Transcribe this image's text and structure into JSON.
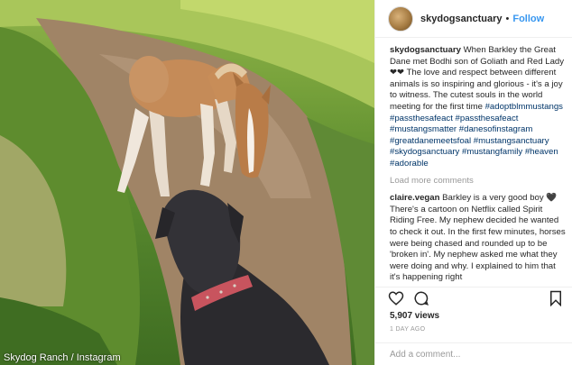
{
  "photo": {
    "credit": "Skydog Ranch / Instagram",
    "collar_color": "#c8545e"
  },
  "header": {
    "handle": "skydogsanctuary",
    "separator": "•",
    "follow_label": "Follow",
    "follow_color": "#3897f0"
  },
  "caption": {
    "author": "skydogsanctuary",
    "text": "When Barkley the Great Dane met Bodhi son of Goliath and Red Lady ❤❤ The love and respect between different animals is so inspiring and glorious - it's a joy to witness. The cutest souls in the world meeting for the first time",
    "tags": "#adoptblmmustangs #passthesafeact #passthesafeact #mustangsmatter #danesofinstagram #greatdanemeetsfoal #mustangsanctuary #skydogsanctuary #mustangfamily #heaven #adorable"
  },
  "load_more": "Load more comments",
  "comment": {
    "author": "claire.vegan",
    "text": "Barkley is a very good boy 🖤 There's a cartoon on Netflix called Spirit Riding Free. My nephew decided he wanted to check it out. In the first few minutes, horses were being chased and rounded up to be 'broken in'. My nephew asked me what they were doing and why. I explained to him that it's happening right"
  },
  "actions": {
    "like_icon": "heart-icon",
    "comment_icon": "comment-bubble-icon",
    "save_icon": "bookmark-icon"
  },
  "views": "5,907 views",
  "time": "1 DAY AGO",
  "add_comment_placeholder": "Add a comment..."
}
